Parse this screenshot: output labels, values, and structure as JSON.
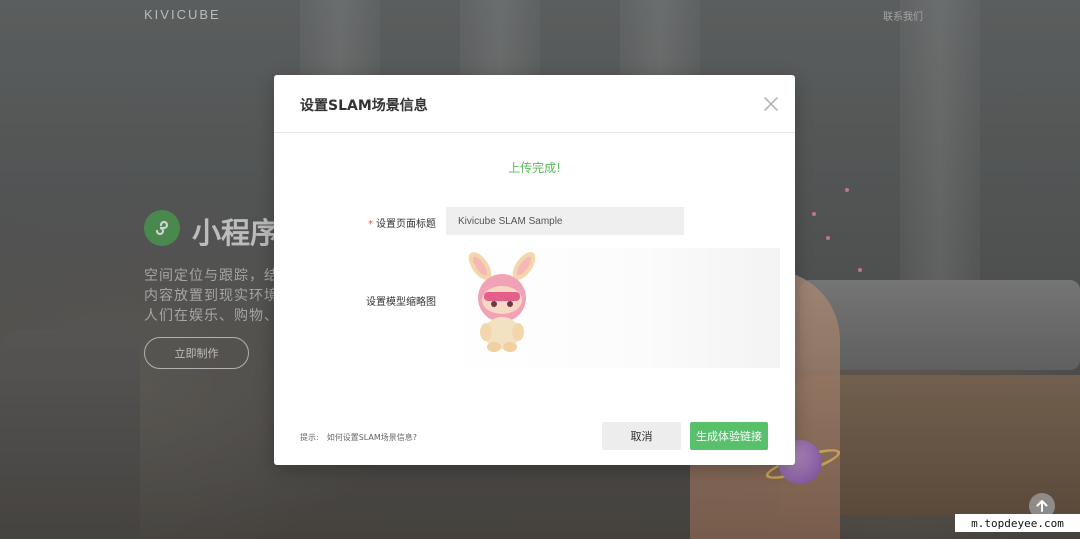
{
  "header": {
    "logo": "KIVICUBE",
    "contact_label": "联系我们"
  },
  "hero": {
    "title": "小程序",
    "lines": [
      "空间定位与跟踪，结",
      "内容放置到现实环境",
      "人们在娱乐、购物、"
    ],
    "cta_label": "立即制作"
  },
  "modal": {
    "title": "设置SLAM场景信息",
    "upload_status": "上传完成!",
    "page_title_field": {
      "required_mark": "*",
      "label": "设置页面标题",
      "value": "Kivicube SLAM Sample"
    },
    "thumbnail_field": {
      "label": "设置模型缩略图"
    },
    "tip_label": "提示:",
    "tip_link": "如何设置SLAM场景信息?",
    "cancel_label": "取消",
    "generate_label": "生成体验链接"
  },
  "watermark": "m.topdeyee.com",
  "colors": {
    "accent_green": "#58c06b",
    "status_green": "#5cb85c",
    "required_red": "#e84d4d"
  },
  "icons": {
    "close": "close-icon",
    "scroll_top": "arrow-up-icon",
    "mini_program": "mini-program-icon"
  }
}
